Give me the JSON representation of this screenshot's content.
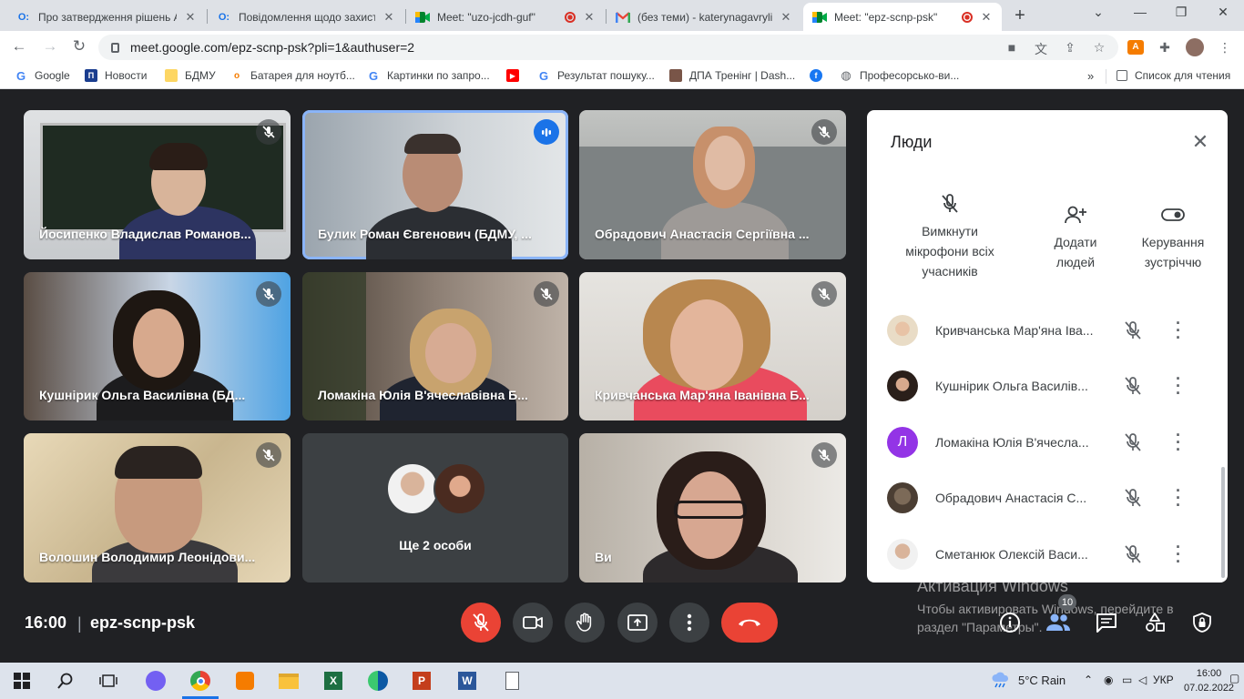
{
  "browser": {
    "tabs": [
      {
        "title": "Про затвердження рішень А",
        "favicon": "docs-icon",
        "color": "#1a73e8"
      },
      {
        "title": "Повідомлення щодо захист",
        "favicon": "docs-icon",
        "color": "#1a73e8"
      },
      {
        "title": "Meet: \"uzo-jcdh-guf\"",
        "favicon": "meet-icon",
        "color": "#00832d"
      },
      {
        "title": "(без теми) - katerynagavrylia",
        "favicon": "gmail-icon",
        "color": "#ea4335"
      },
      {
        "title": "Meet: \"epz-scnp-psk\"",
        "favicon": "meet-icon",
        "color": "#00832d"
      }
    ],
    "url": "meet.google.com/epz-scnp-psk?pli=1&authuser=2",
    "bookmarks": [
      "Google",
      "Новости",
      "БДМУ",
      "Батарея для ноутб...",
      "Картинки по запро...",
      "Результат пошуку...",
      "ДПА Тренінг | Dash...",
      "Професорсько-ви..."
    ],
    "reading_list": "Список для чтения"
  },
  "meeting": {
    "time": "16:00",
    "code": "epz-scnp-psk",
    "participants_tiles": [
      {
        "name": "Йосипенко Владислав Романов..."
      },
      {
        "name": "Булик Роман Євгенович (БДМУ, ..."
      },
      {
        "name": "Обрадович Анастасія Сергіївна ..."
      },
      {
        "name": "Кушнірик Ольга Василівна (БД..."
      },
      {
        "name": "Ломакіна Юлія В'ячеславівна Б..."
      },
      {
        "name": "Кривчанська Мар'яна Іванівна Б..."
      },
      {
        "name": "Волошин Володимир Леонідови..."
      },
      {
        "name": "Ще 2 особи"
      },
      {
        "name": "Ви"
      }
    ],
    "people_count": "10"
  },
  "people_panel": {
    "title": "Люди",
    "actions": [
      {
        "label": "Вимкнути мікрофони всіх учасників"
      },
      {
        "label": "Додати людей"
      },
      {
        "label": "Керування зустріччю"
      }
    ],
    "list": [
      {
        "name": "Кривчанська Мар'яна Іва..."
      },
      {
        "name": "Кушнірик Ольга Василів..."
      },
      {
        "name": "Ломакіна Юлія В'ячесла...",
        "initial": "Л"
      },
      {
        "name": "Обрадович Анастасія С..."
      },
      {
        "name": "Сметанюк Олексій Васи..."
      }
    ]
  },
  "watermark": {
    "line1": "Активация Windows",
    "line2": "Чтобы активировать Windows, перейдите в раздел \"Параметры\"."
  },
  "taskbar": {
    "weather": "5°C  Rain",
    "lang": "УКР",
    "time": "16:00",
    "date": "07.02.2022"
  },
  "colors": {
    "meet_bg": "#202124",
    "tile_bg": "#3c4043",
    "end_call": "#ea4335",
    "speaking": "#8ab4f8"
  }
}
